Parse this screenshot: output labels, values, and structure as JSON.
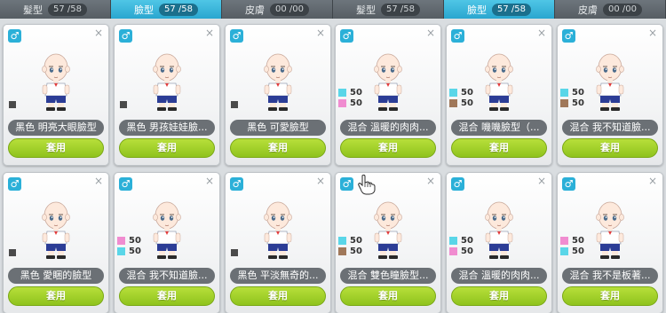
{
  "tabs": [
    {
      "label": "髮型",
      "count": "57 /58",
      "active": false
    },
    {
      "label": "臉型",
      "count": "57 /58",
      "active": true
    },
    {
      "label": "皮膚",
      "count": "00 /00",
      "active": false
    },
    {
      "label": "髮型",
      "count": "57 /58",
      "active": false
    },
    {
      "label": "臉型",
      "count": "57 /58",
      "active": true
    },
    {
      "label": "皮膚",
      "count": "00 /00",
      "active": false
    }
  ],
  "card_common": {
    "gender_symbol": "♂",
    "close_symbol": "×",
    "apply_label": "套用"
  },
  "cards": [
    {
      "name": "黑色  明亮大眼臉型",
      "type": "single"
    },
    {
      "name": "黑色  男孩娃娃臉...",
      "type": "single"
    },
    {
      "name": "黑色  可愛臉型",
      "type": "single"
    },
    {
      "name": "混合  溫暖的肉肉...",
      "type": "mix",
      "mix": [
        {
          "color": "#5ad6e8",
          "value": "50"
        },
        {
          "color": "#f08cd0",
          "value": "50"
        }
      ]
    },
    {
      "name": "混合  嘰嘰臉型（...",
      "type": "mix",
      "mix": [
        {
          "color": "#5ad6e8",
          "value": "50"
        },
        {
          "color": "#a0785a",
          "value": "50"
        }
      ]
    },
    {
      "name": "混合  我不知道臉...",
      "type": "mix",
      "mix": [
        {
          "color": "#5ad6e8",
          "value": "50"
        },
        {
          "color": "#a0785a",
          "value": "50"
        }
      ]
    },
    {
      "name": "黑色  愛睏的臉型",
      "type": "single"
    },
    {
      "name": "混合  我不知道臉...",
      "type": "mix",
      "mix": [
        {
          "color": "#f08cd0",
          "value": "50"
        },
        {
          "color": "#5ad6e8",
          "value": "50"
        }
      ]
    },
    {
      "name": "黑色  平淡無奇的...",
      "type": "single"
    },
    {
      "name": "混合  雙色瞳臉型...",
      "type": "mix",
      "mix": [
        {
          "color": "#5ad6e8",
          "value": "50"
        },
        {
          "color": "#a0785a",
          "value": "50"
        }
      ]
    },
    {
      "name": "混合  溫暖的肉肉...",
      "type": "mix",
      "mix": [
        {
          "color": "#5ad6e8",
          "value": "50"
        },
        {
          "color": "#f08cd0",
          "value": "50"
        }
      ]
    },
    {
      "name": "混合  我不是板著...",
      "type": "mix",
      "mix": [
        {
          "color": "#f08cd0",
          "value": "50"
        },
        {
          "color": "#5ad6e8",
          "value": "50"
        }
      ]
    }
  ]
}
